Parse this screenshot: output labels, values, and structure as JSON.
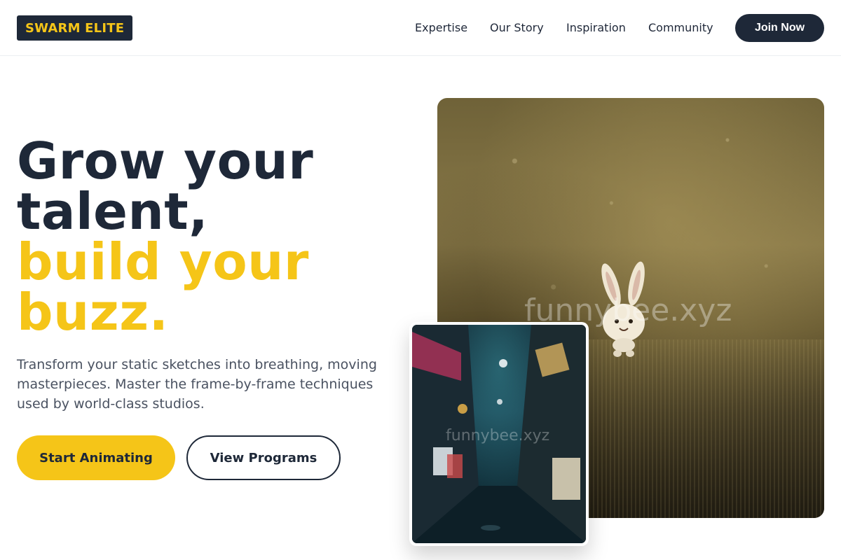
{
  "brand": {
    "name": "SWARM ELITE"
  },
  "nav": {
    "items": [
      "Expertise",
      "Our Story",
      "Inspiration",
      "Community"
    ],
    "cta_label": "Join Now"
  },
  "hero": {
    "headline_line1": "Grow your",
    "headline_line2": "talent,",
    "headline_line3": "build your",
    "headline_line4": "buzz.",
    "subtext": "Transform your static sketches into breathing, moving masterpieces. Master the frame-by-frame techniques used by world-class studios.",
    "primary_cta": "Start Animating",
    "secondary_cta": "View Programs"
  },
  "images": {
    "main_watermark": "funnybee.xyz",
    "inset_watermark": "funnybee.xyz"
  },
  "colors": {
    "accent": "#f5c518",
    "dark": "#1e2838",
    "body_text": "#4a5261"
  }
}
